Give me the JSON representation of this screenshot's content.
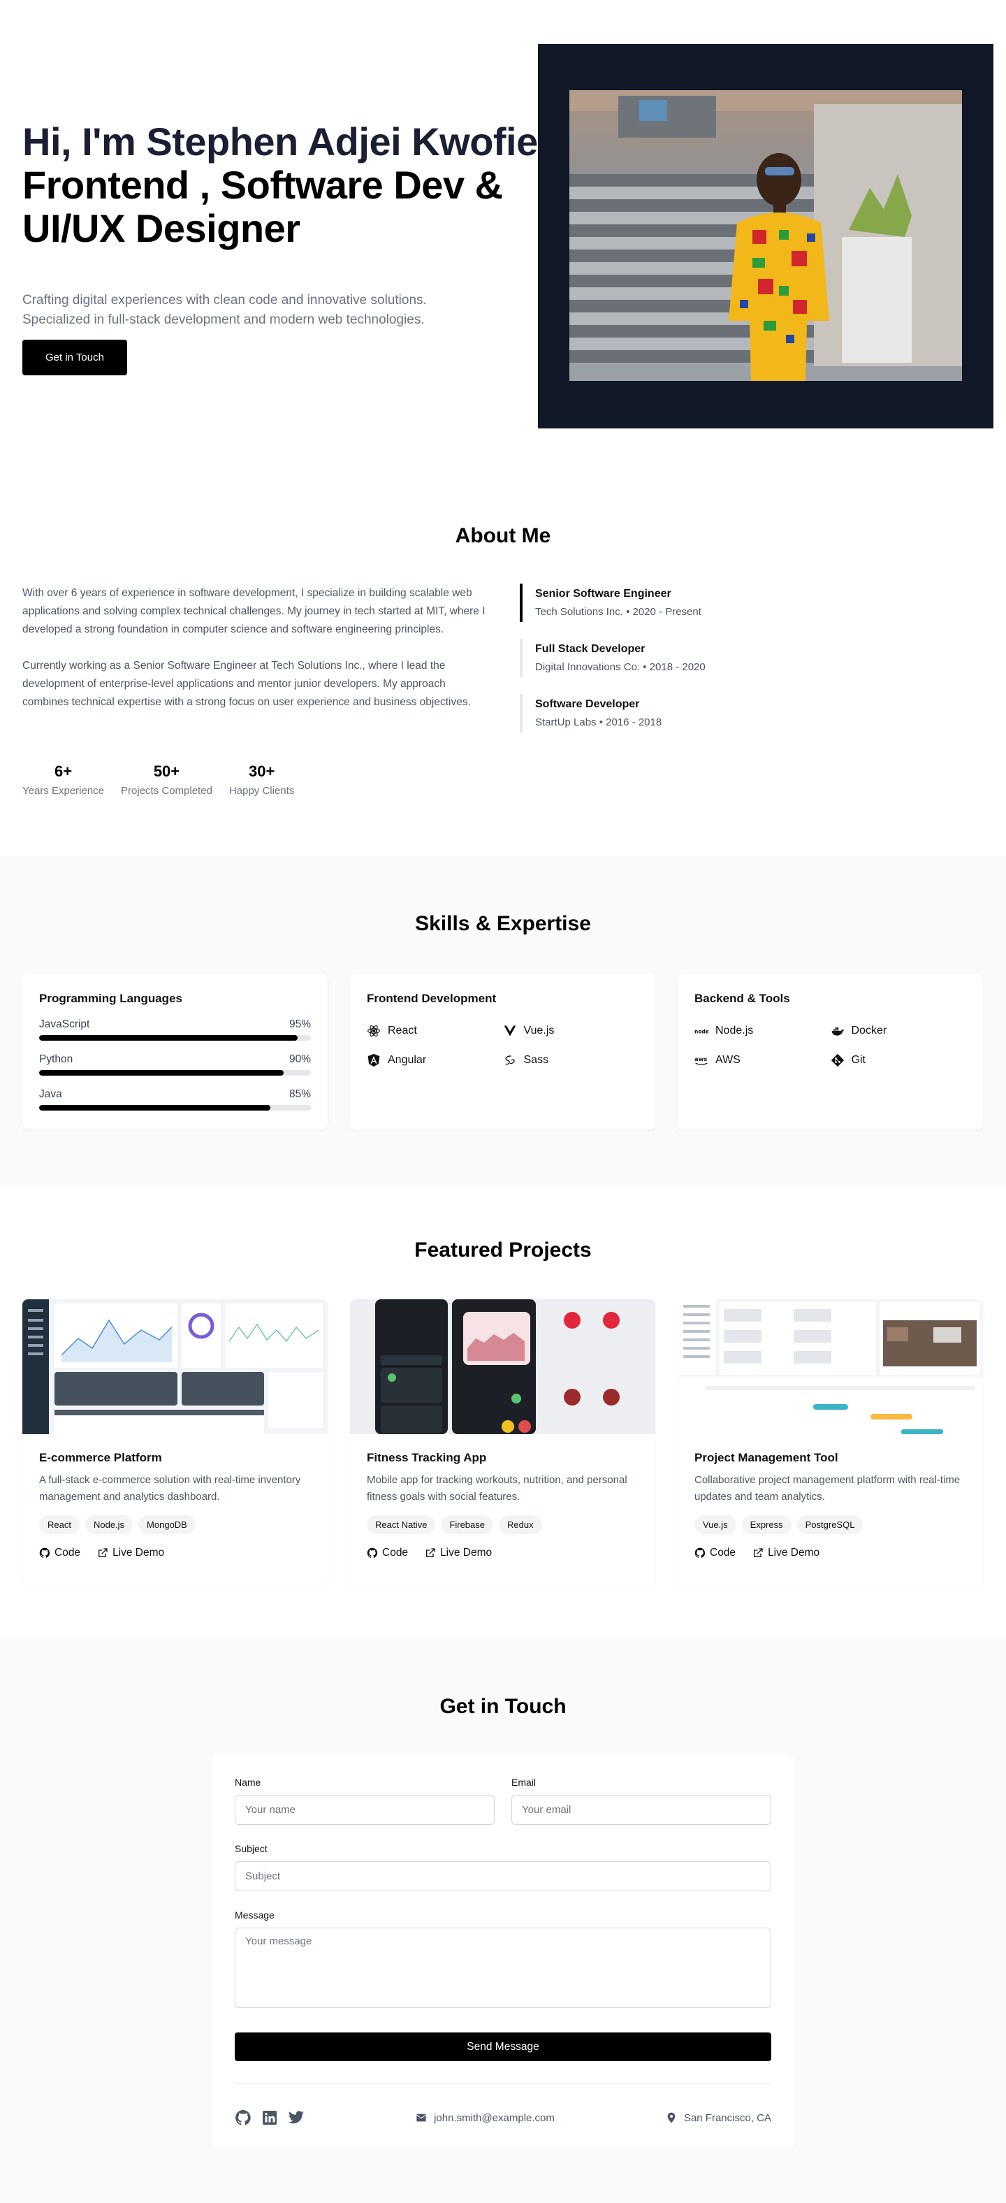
{
  "hero": {
    "title_line1": "Hi, I'm Stephen  Adjei Kwofie",
    "title_line2": "Frontend , Software Dev &",
    "title_line3": "UI/UX Designer",
    "description": "Crafting digital experiences with clean code and innovative solutions. Specialized in full-stack development and modern web technologies.",
    "cta_label": "Get in Touch"
  },
  "about": {
    "title": "About Me",
    "paragraph1": "With over 6 years of experience in software development, I specialize in building scalable web applications and solving complex technical challenges. My journey in tech started at MIT, where I developed a strong foundation in computer science and software engineering principles.",
    "paragraph2": "Currently working as a Senior Software Engineer at Tech Solutions Inc., where I lead the development of enterprise-level applications and mentor junior developers. My approach combines technical expertise with a strong focus on user experience and business objectives.",
    "stats": [
      {
        "value": "6+",
        "label": "Years Experience"
      },
      {
        "value": "50+",
        "label": "Projects Completed"
      },
      {
        "value": "30+",
        "label": "Happy Clients"
      }
    ],
    "timeline": [
      {
        "title": "Senior Software Engineer",
        "subtitle": "Tech Solutions Inc. • 2020 - Present"
      },
      {
        "title": "Full Stack Developer",
        "subtitle": "Digital Innovations Co. • 2018 - 2020"
      },
      {
        "title": "Software Developer",
        "subtitle": "StartUp Labs • 2016 - 2018"
      }
    ]
  },
  "skills": {
    "title": "Skills & Expertise",
    "languages": {
      "title": "Programming Languages",
      "items": [
        {
          "name": "JavaScript",
          "percent_label": "95%",
          "level": 95
        },
        {
          "name": "Python",
          "percent_label": "90%",
          "level": 90
        },
        {
          "name": "Java",
          "percent_label": "85%",
          "level": 85
        }
      ]
    },
    "frontend": {
      "title": "Frontend Development",
      "items": [
        {
          "name": "React",
          "icon": "react-icon"
        },
        {
          "name": "Vue.js",
          "icon": "vue-icon"
        },
        {
          "name": "Angular",
          "icon": "angular-icon"
        },
        {
          "name": "Sass",
          "icon": "sass-icon"
        }
      ]
    },
    "backend": {
      "title": "Backend & Tools",
      "items": [
        {
          "name": "Node.js",
          "icon": "nodejs-icon"
        },
        {
          "name": "Docker",
          "icon": "docker-icon"
        },
        {
          "name": "AWS",
          "icon": "aws-icon"
        },
        {
          "name": "Git",
          "icon": "git-icon"
        }
      ]
    }
  },
  "projects": {
    "title": "Featured Projects",
    "code_label": "Code",
    "demo_label": "Live Demo",
    "items": [
      {
        "title": "E-commerce Platform",
        "description": "A full-stack e-commerce solution with real-time inventory management and analytics dashboard.",
        "tags": [
          "React",
          "Node.js",
          "MongoDB"
        ]
      },
      {
        "title": "Fitness Tracking App",
        "description": "Mobile app for tracking workouts, nutrition, and personal fitness goals with social features.",
        "tags": [
          "React Native",
          "Firebase",
          "Redux"
        ]
      },
      {
        "title": "Project Management Tool",
        "description": "Collaborative project management platform with real-time updates and team analytics.",
        "tags": [
          "Vue.js",
          "Express",
          "PostgreSQL"
        ]
      }
    ]
  },
  "contact": {
    "title": "Get in Touch",
    "name_label": "Name",
    "name_placeholder": "Your name",
    "email_label": "Email",
    "email_placeholder": "Your email",
    "subject_label": "Subject",
    "subject_placeholder": "Subject",
    "message_label": "Message",
    "message_placeholder": "Your message",
    "submit_label": "Send Message",
    "email": "john.smith@example.com",
    "location": "San Francisco, CA"
  },
  "colors": {
    "primary": "#000000",
    "hero_frame": "#111827",
    "section_alt_bg": "#f9fafb",
    "muted_text": "#6b7280"
  }
}
